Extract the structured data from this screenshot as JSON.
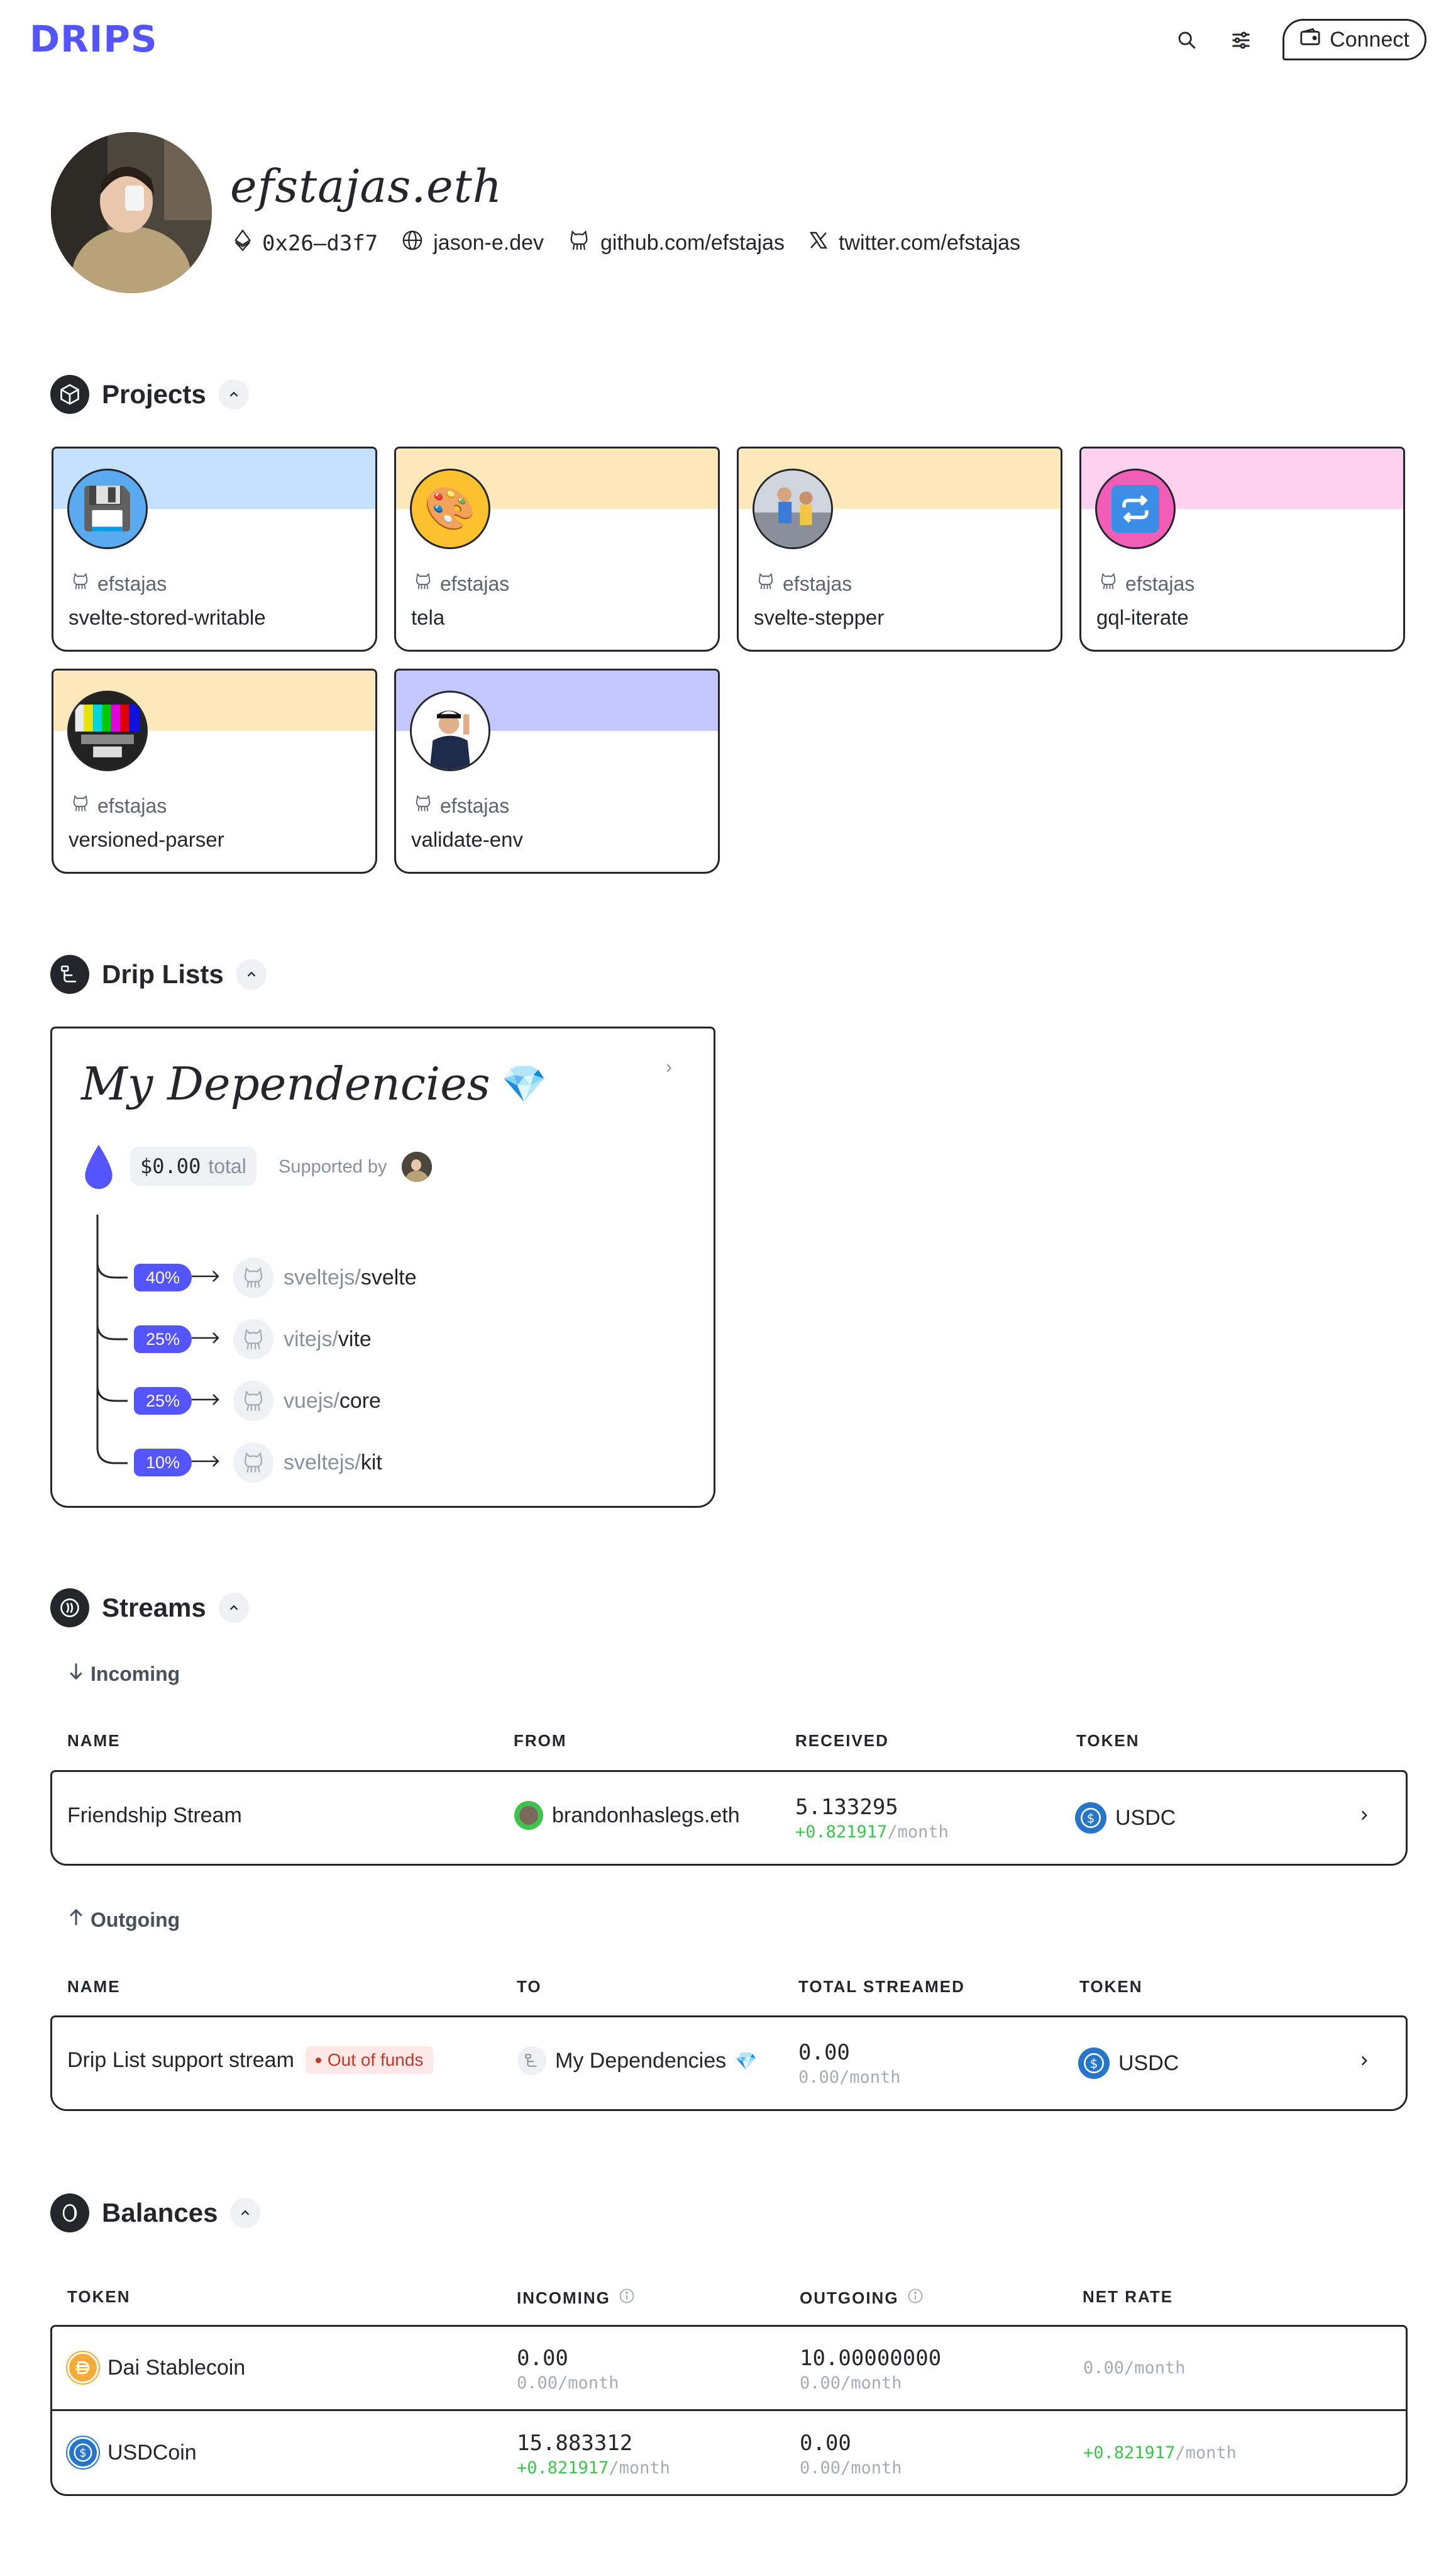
{
  "header": {
    "logo": "DRIPS",
    "connect_label": "Connect",
    "icons": [
      "search-icon",
      "settings-sliders-icon",
      "wallet-icon"
    ]
  },
  "profile": {
    "name": "efstajas.eth",
    "address": "0x26–d3f7",
    "website": "jason-e.dev",
    "github": "github.com/efstajas",
    "twitter": "twitter.com/efstajas"
  },
  "projects": {
    "title": "Projects",
    "items": [
      {
        "owner": "efstajas",
        "name": "svelte-stored-writable",
        "color": "#c4e0ff",
        "emoji": "💾"
      },
      {
        "owner": "efstajas",
        "name": "tela",
        "color": "#fde8bc",
        "emoji": "🎨"
      },
      {
        "owner": "efstajas",
        "name": "svelte-stepper",
        "color": "#fde8bc",
        "emoji": ""
      },
      {
        "owner": "efstajas",
        "name": "gql-iterate",
        "color": "#fdd0f0",
        "emoji": "🔁"
      },
      {
        "owner": "efstajas",
        "name": "versioned-parser",
        "color": "#fde8bc",
        "emoji": ""
      },
      {
        "owner": "efstajas",
        "name": "validate-env",
        "color": "#c4c6ff",
        "emoji": ""
      }
    ]
  },
  "drip_lists": {
    "title": "Drip Lists",
    "list": {
      "name": "My Dependencies",
      "emoji": "💎",
      "total_amount": "$0.00",
      "total_label": "total",
      "supported_by": "Supported by",
      "recipients": [
        {
          "pct": "40%",
          "owner": "sveltejs/",
          "repo": "svelte"
        },
        {
          "pct": "25%",
          "owner": "vitejs/",
          "repo": "vite"
        },
        {
          "pct": "25%",
          "owner": "vuejs/",
          "repo": "core"
        },
        {
          "pct": "10%",
          "owner": "sveltejs/",
          "repo": "kit"
        }
      ]
    }
  },
  "streams": {
    "title": "Streams",
    "incoming": {
      "label": "Incoming",
      "headers": [
        "NAME",
        "FROM",
        "RECEIVED",
        "TOKEN"
      ],
      "rows": [
        {
          "name": "Friendship Stream",
          "from": "brandonhaslegs.eth",
          "amount": "5.133295",
          "rate": "+0.821917",
          "per": "/month",
          "token": "USDC"
        }
      ]
    },
    "outgoing": {
      "label": "Outgoing",
      "headers": [
        "NAME",
        "TO",
        "TOTAL STREAMED",
        "TOKEN"
      ],
      "rows": [
        {
          "name": "Drip List support stream",
          "badge": "Out of funds",
          "to": "My Dependencies",
          "to_emoji": "💎",
          "amount": "0.00",
          "rate": "0.00",
          "per": "/month",
          "token": "USDC"
        }
      ]
    }
  },
  "balances": {
    "title": "Balances",
    "headers": [
      "TOKEN",
      "INCOMING",
      "OUTGOING",
      "NET RATE"
    ],
    "rows": [
      {
        "token": "Dai Stablecoin",
        "in_amount": "0.00",
        "in_rate": "0.00",
        "out_amount": "10.00000000",
        "out_rate": "0.00",
        "net_rate": "0.00",
        "per": "/month"
      },
      {
        "token": "USDCoin",
        "in_amount": "15.883312",
        "in_rate": "+0.821917",
        "out_amount": "0.00",
        "out_rate": "0.00",
        "net_rate": "+0.821917",
        "per": "/month"
      }
    ]
  },
  "colors": {
    "accent": "#5555ff",
    "positive": "#3ec44c",
    "danger": "#c0392b"
  }
}
